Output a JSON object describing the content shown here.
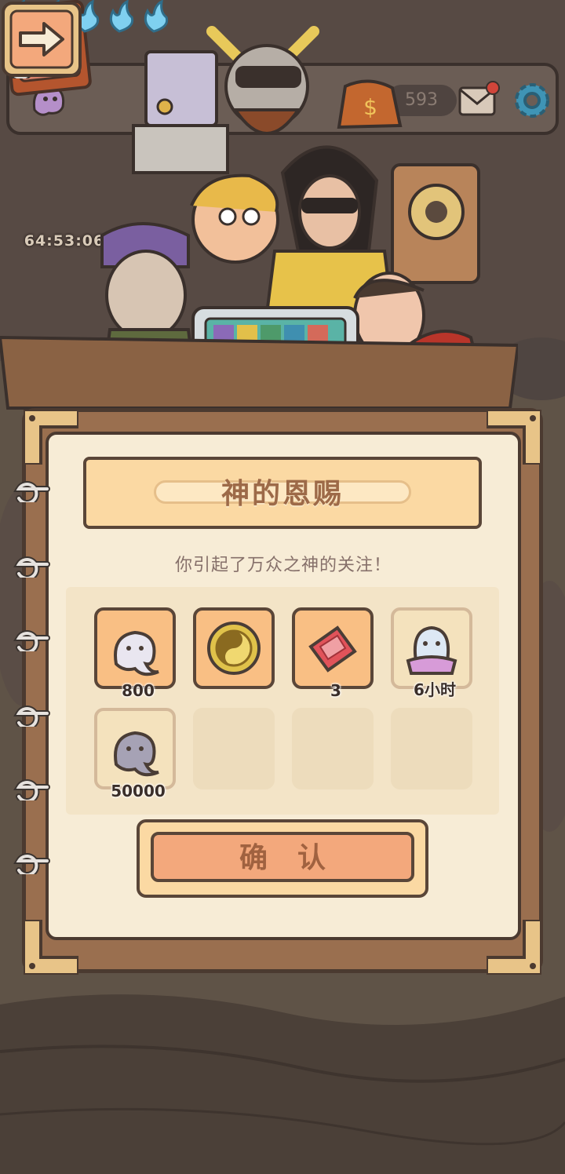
{
  "hud": {
    "currency_value": "593"
  },
  "event": {
    "timer": "64:53:06"
  },
  "dialog": {
    "title": "神的恩赐",
    "flame_count": 5,
    "subtitle": "你引起了万众之神的关注！",
    "rewards": [
      {
        "icon": "white-ghost-icon",
        "label": "800"
      },
      {
        "icon": "yin-yang-coin-icon",
        "label": ""
      },
      {
        "icon": "red-ticket-icon",
        "label": "3"
      },
      {
        "icon": "ghost-doll-icon",
        "label": "6小时"
      },
      {
        "icon": "gray-ghost-icon",
        "label": "50000"
      }
    ],
    "confirm_label": "确认"
  },
  "colors": {
    "accent_flame": "#5ab6e0",
    "panel_paper": "#f7ecd6",
    "slot_orange": "#f9bf84",
    "title_text": "#9d6a48"
  }
}
